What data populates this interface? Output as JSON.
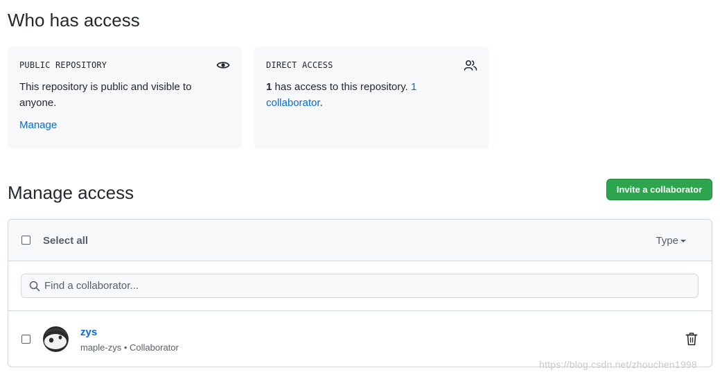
{
  "who_has_access": {
    "title": "Who has access",
    "public_card": {
      "label": "PUBLIC REPOSITORY",
      "icon": "eye-icon",
      "text": "This repository is public and visible to anyone.",
      "link": "Manage"
    },
    "direct_card": {
      "label": "DIRECT ACCESS",
      "icon": "people-icon",
      "count": "1",
      "text": " has access to this repository. ",
      "link": "1 collaborator",
      "suffix": "."
    }
  },
  "manage_access": {
    "title": "Manage access",
    "invite_button": "Invite a collaborator",
    "select_all": "Select all",
    "type_filter": "Type",
    "search_placeholder": "Find a collaborator...",
    "members": [
      {
        "name": "zys",
        "login": "maple-zys",
        "separator": " • ",
        "role": "Collaborator"
      }
    ]
  },
  "watermark": "https://blog.csdn.net/zhouchen1998",
  "colors": {
    "accent_link": "#0969da",
    "primary_button": "#2da44e",
    "card_background": "#f6f8fa",
    "border": "#d0d7de"
  }
}
